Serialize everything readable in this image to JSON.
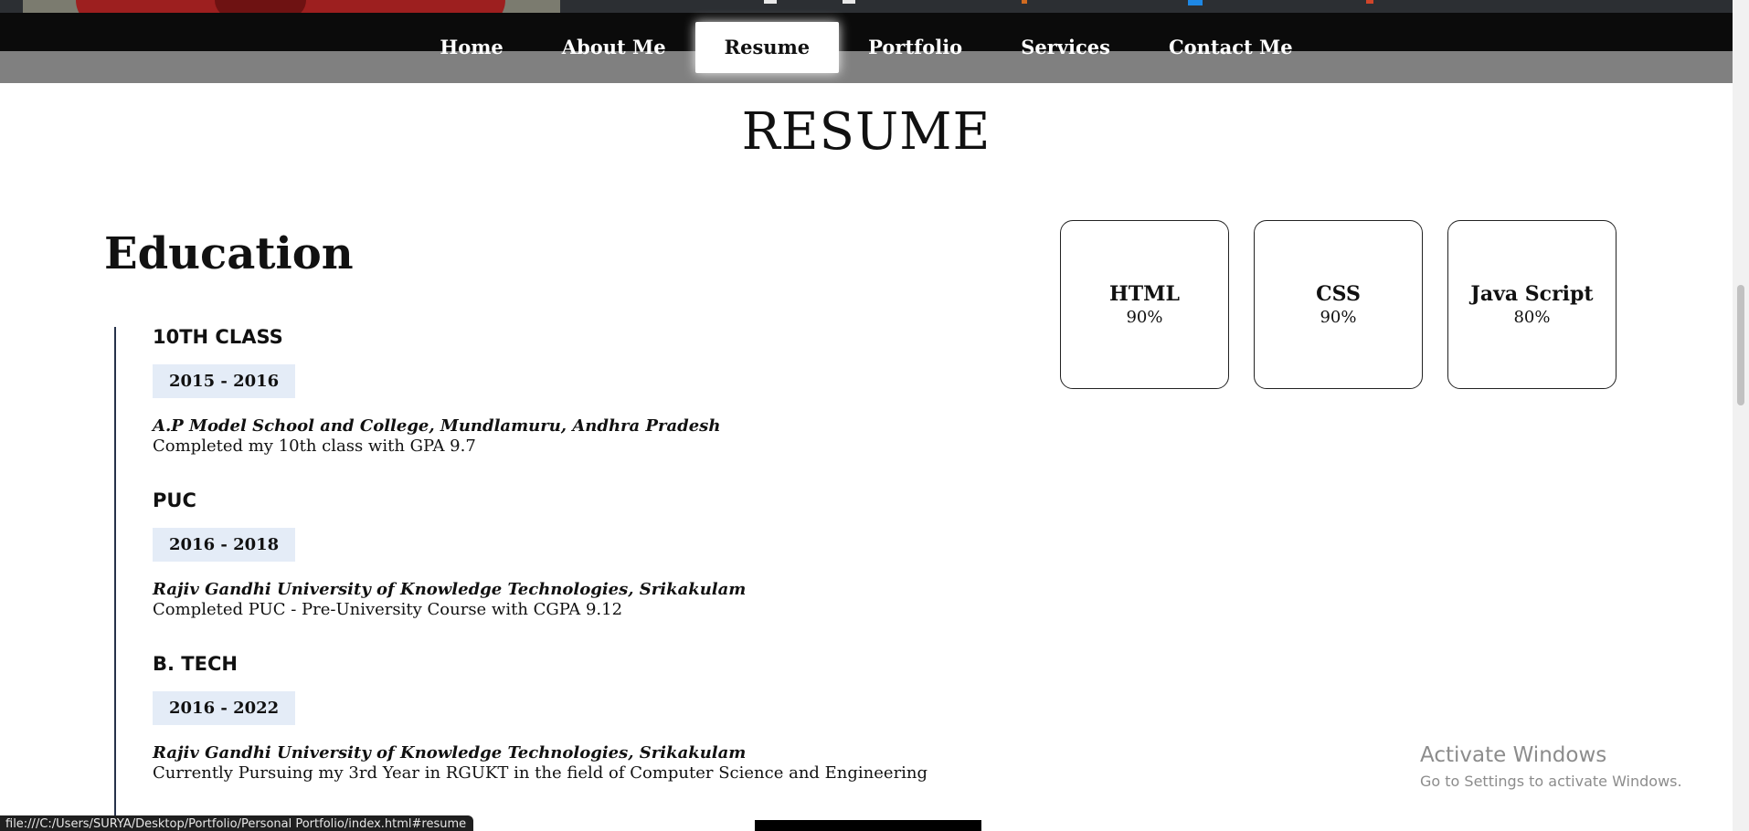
{
  "nav": {
    "items": [
      "Home",
      "About Me",
      "Resume",
      "Portfolio",
      "Services",
      "Contact Me"
    ],
    "active": "Resume"
  },
  "resume": {
    "title": "RESUME"
  },
  "education": {
    "title": "Education",
    "items": [
      {
        "heading": "10TH CLASS",
        "years": "2015 - 2016",
        "school": "A.P Model School and College, Mundlamuru, Andhra Pradesh",
        "description": "Completed my 10th class with GPA 9.7"
      },
      {
        "heading": "PUC",
        "years": "2016 - 2018",
        "school": "Rajiv Gandhi University of Knowledge Technologies, Srikakulam",
        "description": "Completed PUC - Pre-University Course with CGPA 9.12"
      },
      {
        "heading": "B. TECH",
        "years": "2016 - 2022",
        "school": "Rajiv Gandhi University of Knowledge Technologies, Srikakulam",
        "description": "Currently Pursuing my 3rd Year in RGUKT in the field of Computer Science and Engineering"
      }
    ]
  },
  "skills": [
    {
      "name": "HTML",
      "percent": "90%"
    },
    {
      "name": "CSS",
      "percent": "90%"
    },
    {
      "name": "Java Script",
      "percent": "80%"
    }
  ],
  "watermark": {
    "title": "Activate Windows",
    "subtitle": "Go to Settings to activate Windows."
  },
  "status_bar": {
    "url": "file:///C:/Users/SURYA/Desktop/Portfolio/Personal Portfolio/index.html#resume"
  },
  "colors": {
    "nav_bg": "#0b0b0b",
    "nav_shadow": "#808080",
    "year_badge_bg": "#e4ecf7",
    "timeline": "#27324a"
  }
}
